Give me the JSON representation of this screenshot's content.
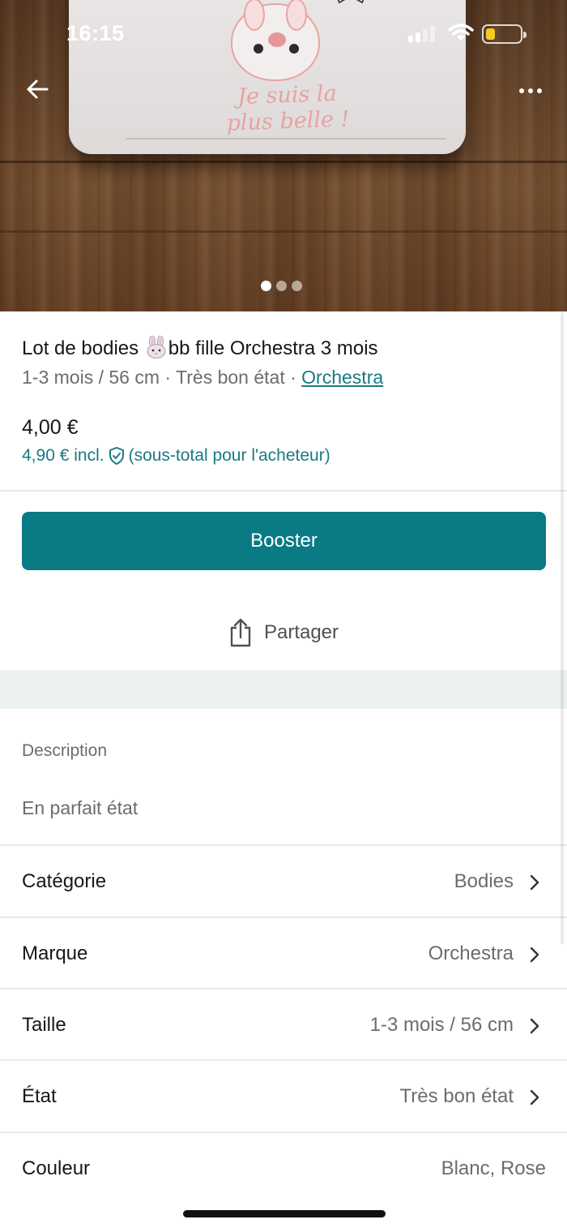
{
  "status_bar": {
    "time": "16:15",
    "battery_level": 0.25,
    "battery_color": "#f2cb1f",
    "signal_bars": 2
  },
  "gallery": {
    "garment_print": "Je suis la plus belle !",
    "image_count": 3,
    "active_index": 0
  },
  "item": {
    "title_part1": "Lot de bodies",
    "title_emoji": "bunny-icon",
    "title_part2": "bb fille Orchestra 3 mois",
    "size": "1-3 mois / 56 cm",
    "separator": "·",
    "condition": "Très bon état",
    "brand_link": "Orchestra",
    "price": "4,00 €",
    "price_incl": "4,90 € incl.",
    "price_incl_note": "(sous-total pour l'acheteur)"
  },
  "actions": {
    "booster_label": "Booster",
    "share_label": "Partager"
  },
  "description": {
    "label": "Description",
    "text": "En parfait état"
  },
  "details": [
    {
      "label": "Catégorie",
      "value": "Bodies",
      "chevron": true
    },
    {
      "label": "Marque",
      "value": "Orchestra",
      "chevron": true
    },
    {
      "label": "Taille",
      "value": "1-3 mois / 56 cm",
      "chevron": true
    },
    {
      "label": "État",
      "value": "Très bon état",
      "chevron": true
    },
    {
      "label": "Couleur",
      "value": "Blanc, Rose",
      "chevron": false
    }
  ],
  "colors": {
    "accent": "#0a7a85",
    "link": "#1a7a82"
  }
}
